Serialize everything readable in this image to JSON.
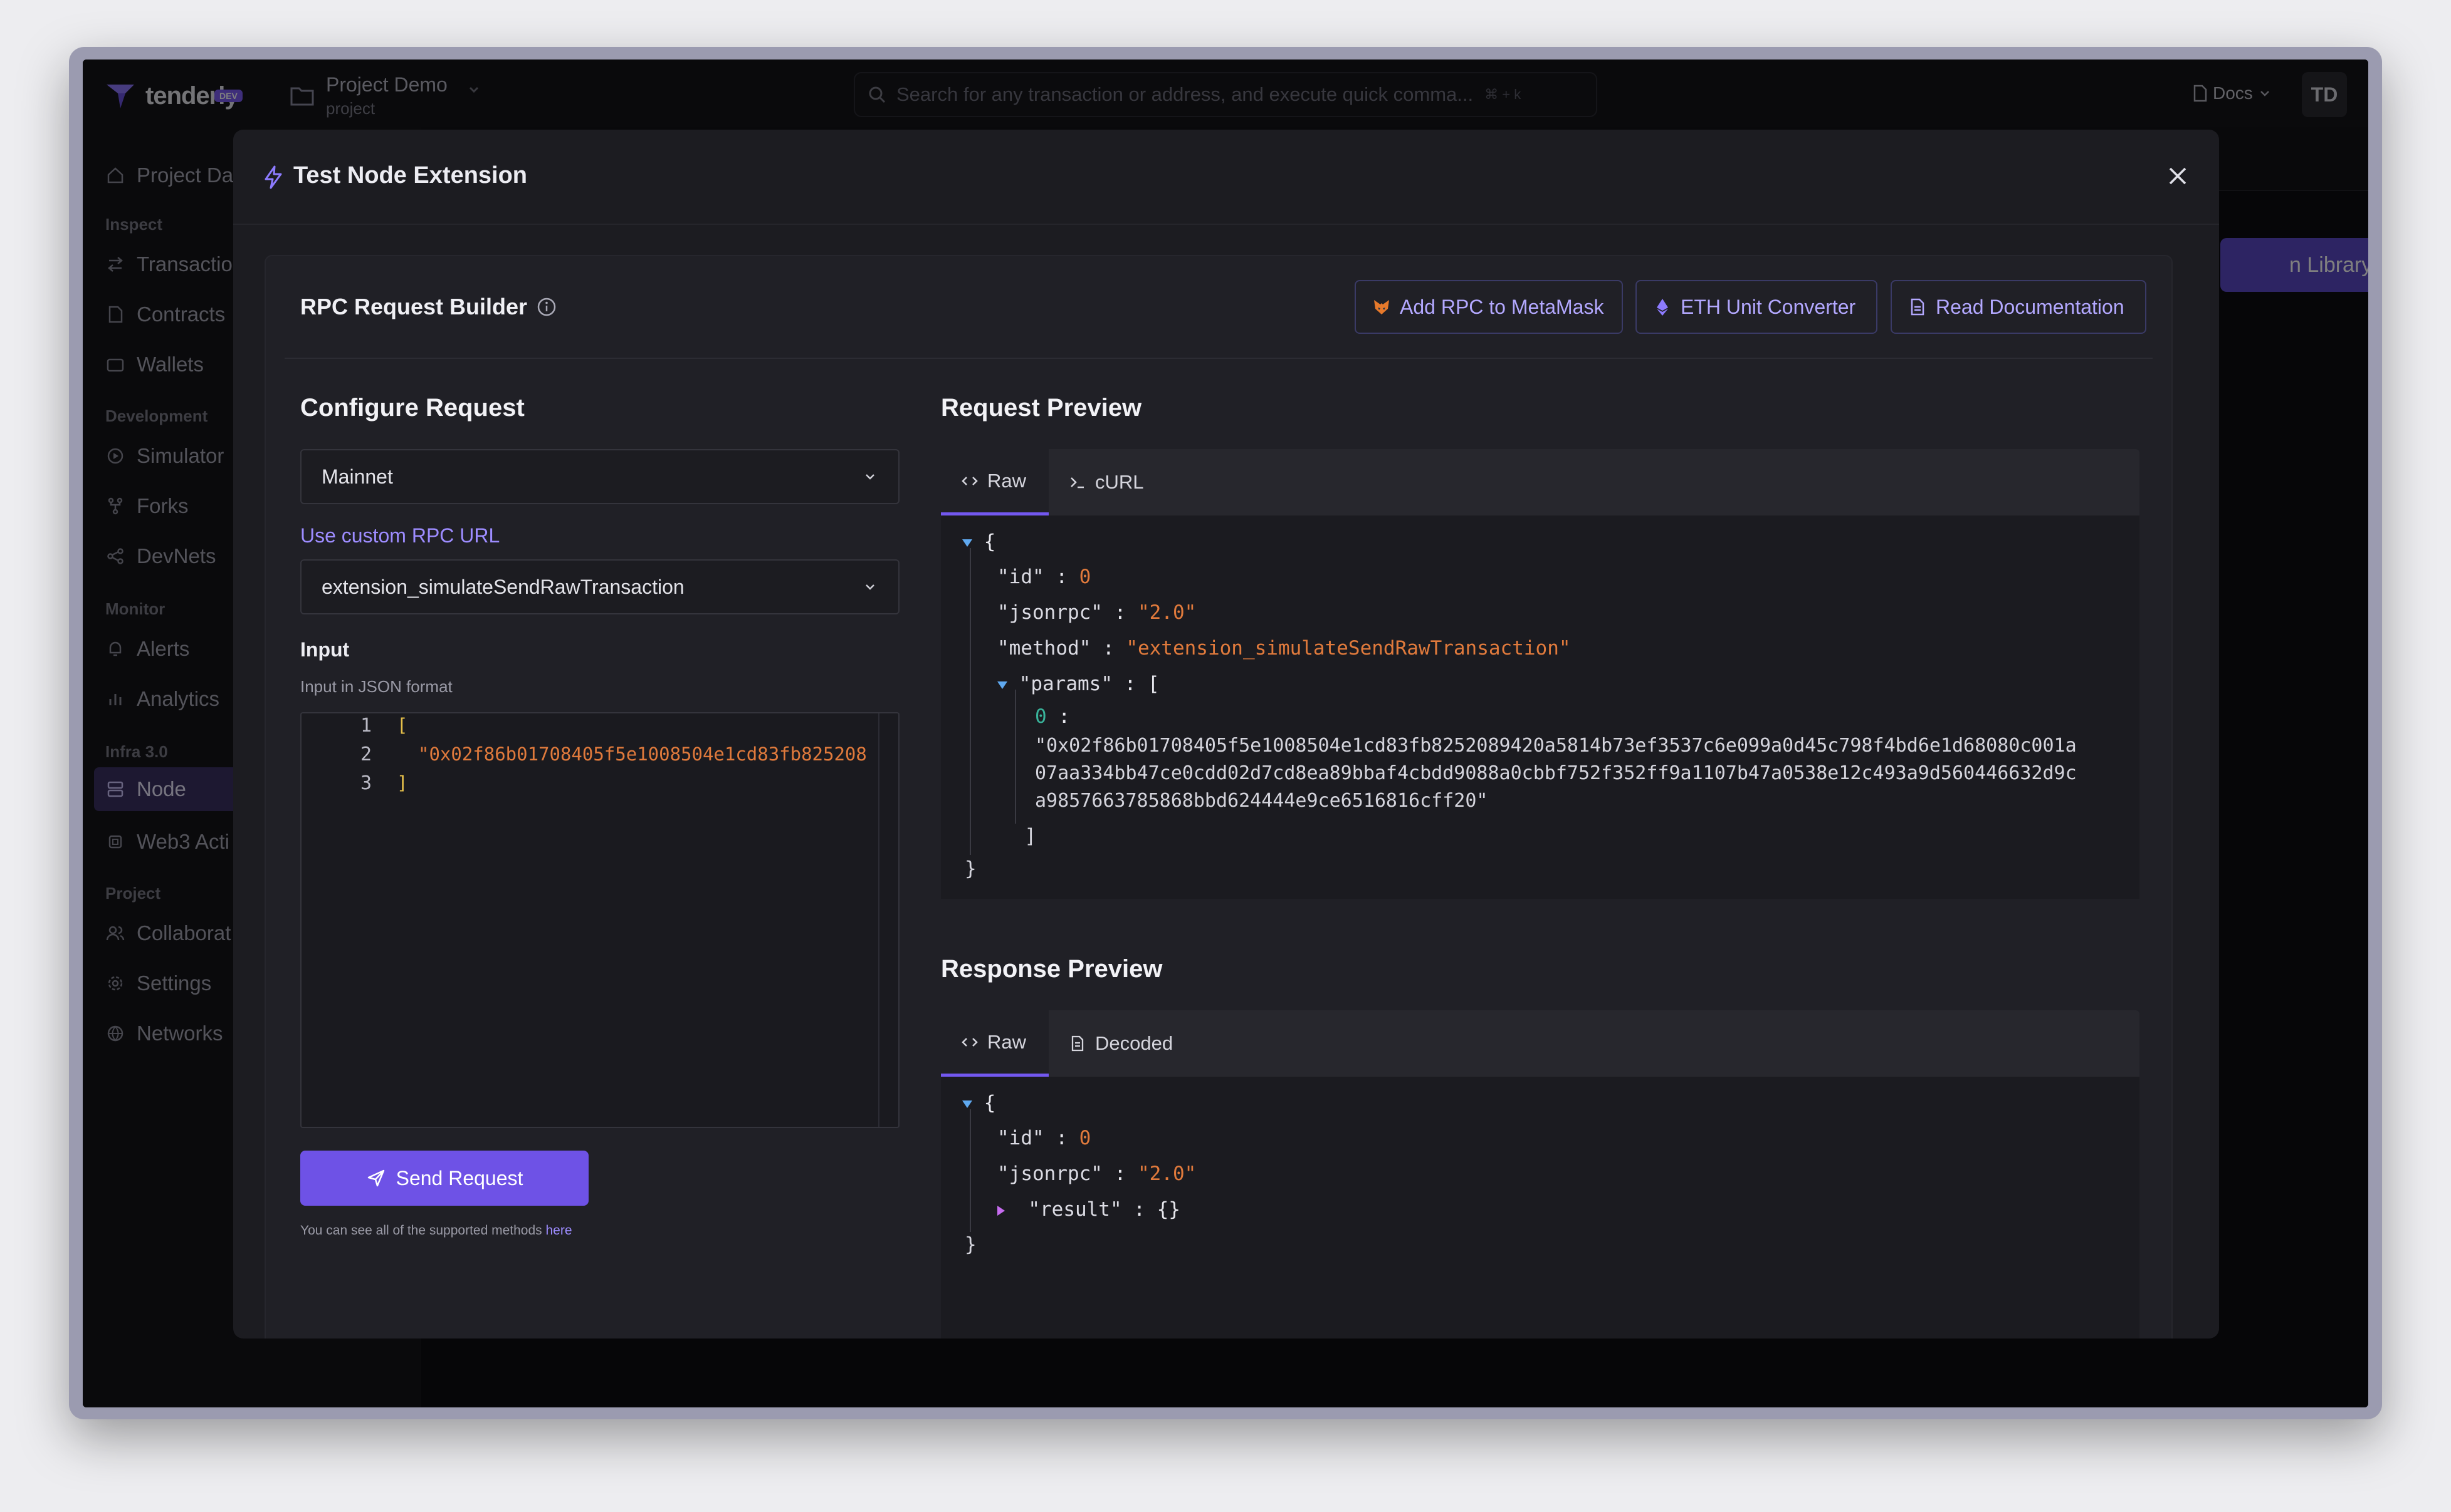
{
  "topbar": {
    "logo_text": "tenderly",
    "logo_badge": "DEV",
    "project_name": "Project Demo",
    "project_sub": "project",
    "search_placeholder": "Search for any transaction or address, and execute quick comma...",
    "shortcut": "⌘ + k",
    "docs_label": "Docs",
    "avatar_initials": "TD"
  },
  "sidebar": {
    "dashboard": "Project Da",
    "sections": {
      "inspect": "Inspect",
      "development": "Development",
      "monitor": "Monitor",
      "infra": "Infra 3.0",
      "project": "Project"
    },
    "items": {
      "transactions": "Transactio",
      "contracts": "Contracts",
      "wallets": "Wallets",
      "simulator": "Simulator",
      "forks": "Forks",
      "devnets": "DevNets",
      "alerts": "Alerts",
      "analytics": "Analytics",
      "node": "Node",
      "web3actions": "Web3 Acti",
      "collaborators": "Collaborat",
      "settings": "Settings",
      "networks": "Networks"
    }
  },
  "background": {
    "library_button": "n Library"
  },
  "modal": {
    "title": "Test Node Extension",
    "builder_title": "RPC Request Builder",
    "buttons": {
      "metamask": "Add RPC to MetaMask",
      "unit_converter": "ETH Unit Converter",
      "documentation": "Read Documentation"
    },
    "configure": {
      "heading": "Configure Request",
      "network": "Mainnet",
      "custom_rpc": "Use custom RPC URL",
      "method": "extension_simulateSendRawTransaction",
      "input_label": "Input",
      "input_hint": "Input in JSON format",
      "editor_lines": [
        "1",
        "2",
        "3"
      ],
      "editor_open": "[",
      "editor_value": "\"0x02f86b01708405f5e1008504e1cd83fb825208",
      "editor_close": "]",
      "send_label": "Send Request",
      "footer_text": "You can see all of the supported methods ",
      "footer_link": "here"
    },
    "request_preview": {
      "heading": "Request Preview",
      "tabs": [
        "Raw",
        "cURL"
      ],
      "id_key": "\"id\"",
      "id_value": "0",
      "jsonrpc_key": "\"jsonrpc\"",
      "jsonrpc_value": "\"2.0\"",
      "method_key": "\"method\"",
      "method_value": "\"extension_simulateSendRawTransaction\"",
      "params_key": "\"params\"",
      "param_index": "0",
      "param_line1": "\"0x02f86b01708405f5e1008504e1cd83fb8252089420a5814b73ef3537c6e099a0d45c798f4bd6e1d68080c001a",
      "param_line2": "07aa334bb47ce0cdd02d7cd8ea89bbaf4cbdd9088a0cbbf752f352ff9a1107b47a0538e12c493a9d560446632d9c",
      "param_line3": "a9857663785868bbd624444e9ce6516816cff20\""
    },
    "response_preview": {
      "heading": "Response Preview",
      "tabs": [
        "Raw",
        "Decoded"
      ],
      "id_key": "\"id\"",
      "id_value": "0",
      "jsonrpc_key": "\"jsonrpc\"",
      "jsonrpc_value": "\"2.0\"",
      "result_key": "\"result\"",
      "result_value": "{}"
    }
  },
  "colors": {
    "accent": "#6e52e6",
    "string": "#e07a3c",
    "index": "#39b39a",
    "background": "#0d0d10"
  }
}
